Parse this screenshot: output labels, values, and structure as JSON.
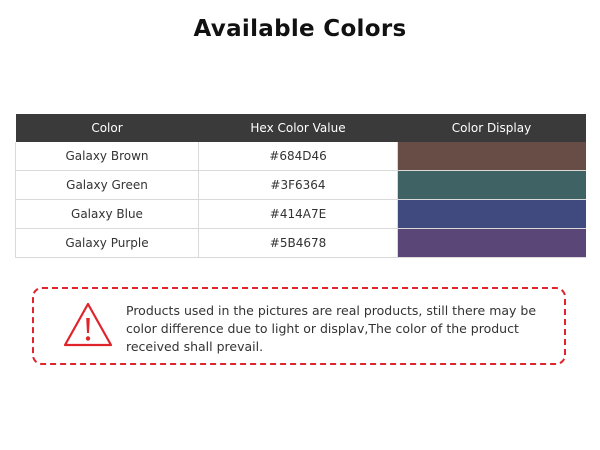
{
  "title": "Available Colors",
  "table": {
    "headers": [
      "Color",
      "Hex Color Value",
      "Color Display"
    ],
    "rows": [
      {
        "name": "Galaxy Brown",
        "hex": "#684D46",
        "swatch": "#684D46"
      },
      {
        "name": "Galaxy Green",
        "hex": "#3F6364",
        "swatch": "#3F6364"
      },
      {
        "name": "Galaxy Blue",
        "hex": "#414A7E",
        "swatch": "#414A7E"
      },
      {
        "name": "Galaxy Purple",
        "hex": "#5B4678",
        "swatch": "#5B4678"
      }
    ]
  },
  "notice": {
    "icon": "warning-triangle-icon",
    "text": "Products used in the pictures are real products, still there may be color difference due to light or displav,The color of the product received shall prevail.",
    "border_color": "#E0242B"
  },
  "colors": {
    "header_bg": "#3A3A3A",
    "accent_red": "#E0242B"
  }
}
